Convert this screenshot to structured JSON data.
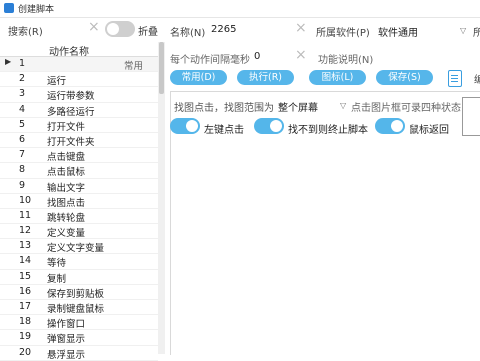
{
  "window": {
    "title": "创建脚本"
  },
  "search": {
    "label": "搜索(R)",
    "value": "",
    "clear_icon": "×"
  },
  "fold": {
    "label": "折叠",
    "on": false
  },
  "actions_table": {
    "header": "动作名称",
    "rows": [
      {
        "num": "1",
        "name": "",
        "category": "常用"
      },
      {
        "num": "2",
        "name": "运行"
      },
      {
        "num": "3",
        "name": "运行带参数"
      },
      {
        "num": "4",
        "name": "多路径运行"
      },
      {
        "num": "5",
        "name": "打开文件"
      },
      {
        "num": "6",
        "name": "打开文件夹"
      },
      {
        "num": "7",
        "name": "点击键盘"
      },
      {
        "num": "8",
        "name": "点击鼠标"
      },
      {
        "num": "9",
        "name": "输出文字"
      },
      {
        "num": "10",
        "name": "找图点击"
      },
      {
        "num": "11",
        "name": "跳转轮盘"
      },
      {
        "num": "12",
        "name": "定义变量"
      },
      {
        "num": "13",
        "name": "定义文字变量"
      },
      {
        "num": "14",
        "name": "等待"
      },
      {
        "num": "15",
        "name": "复制"
      },
      {
        "num": "16",
        "name": "保存到剪贴板"
      },
      {
        "num": "17",
        "name": "录制键盘鼠标"
      },
      {
        "num": "18",
        "name": "操作窗口"
      },
      {
        "num": "19",
        "name": "弹窗显示"
      },
      {
        "num": "20",
        "name": "悬浮显示"
      }
    ],
    "selected_row": "1",
    "selected_marker": "▶"
  },
  "form": {
    "name_label": "名称(N)",
    "name_value": "2265",
    "software_label": "所属软件(P)",
    "software_value": "软件通用",
    "extra_label": "所",
    "interval_label": "每个动作间隔毫秒",
    "interval_value": "0",
    "desc_label": "功能说明(N)"
  },
  "toolbar": {
    "common_label": "常用(D)",
    "execute_label": "执行(R)",
    "icon_label": "图标(L)",
    "save_label": "保存(S)",
    "doc_icon": "document-icon",
    "trailing_label": "编"
  },
  "find_image": {
    "range_label": "找图点击，找图范围为",
    "range_value": "整个屏幕",
    "hint_text": "点击图片框可录四种状态",
    "left_click_label": "左键点击",
    "left_click_on": true,
    "stop_label": "找不到则终止脚本",
    "stop_on": true,
    "mouse_return_label": "鼠标返回",
    "mouse_return_on": true
  },
  "colors": {
    "accent": "#56b6ea",
    "toggle_off": "#cfcfcf"
  }
}
